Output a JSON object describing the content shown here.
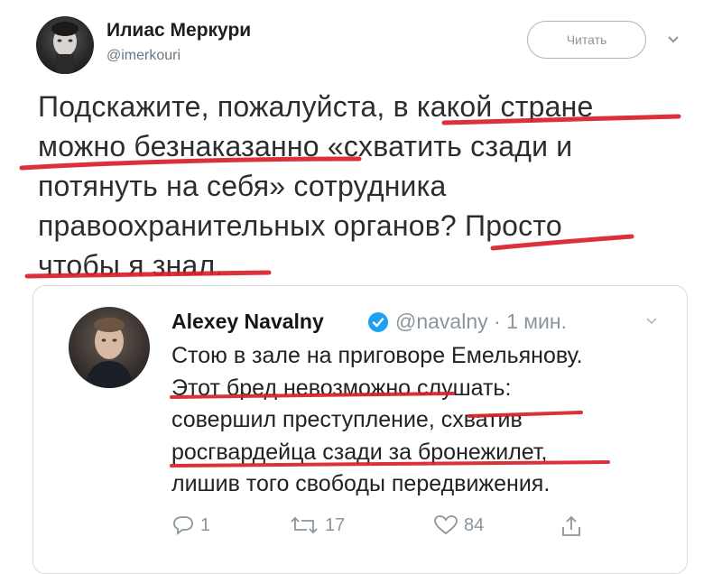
{
  "author": {
    "name": "Илиас Меркури",
    "handle": "@imerkouri"
  },
  "follow_label": "Читать",
  "tweet": {
    "lines": [
      "Подскажите, пожалуйста, в какой стране",
      "можно безнаказанно «схватить сзади и",
      "потянуть на себя» сотрудника",
      "правоохранительных органов? Просто",
      "чтобы я знал."
    ]
  },
  "quoted": {
    "name": "Alexey Navalny",
    "meta": "@navalny · 1 мин.",
    "lines": [
      "Стою в зале на приговоре Емельянову.",
      "Этот бред невозможно слушать:",
      "совершил преступление, схватив",
      "росгвардейца сзади за бронежилет,",
      "лишив того свободы передвижения."
    ],
    "actions": {
      "replies": "1",
      "retweets": "17",
      "likes": "84"
    }
  },
  "icons": {
    "verified": "verified-badge-icon",
    "reply": "reply-icon",
    "retweet": "retweet-icon",
    "like": "heart-icon",
    "share": "share-icon",
    "menu": "chevron-down-icon"
  },
  "colors": {
    "marker": "#d8202a",
    "verified": "#1da1f2",
    "muted": "#8a959c"
  }
}
